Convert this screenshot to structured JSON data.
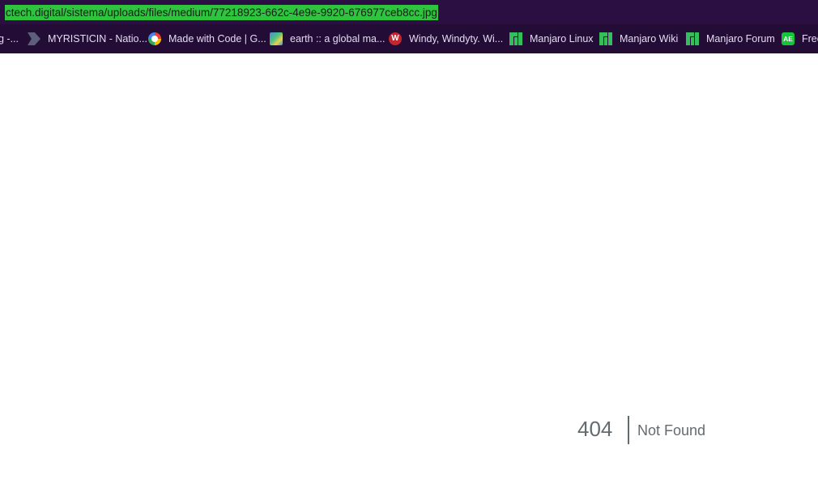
{
  "address_bar": {
    "url": "ctech.digital/sistema/uploads/files/medium/77218923-662c-4e9e-9920-676977ceb8cc.jpg"
  },
  "bookmarks": [
    {
      "label": "g -...",
      "icon": "none"
    },
    {
      "label": "MYRISTICIN - Natio...",
      "icon": "bookmark-gray-icon"
    },
    {
      "label": "Made with Code | G...",
      "icon": "google-icon"
    },
    {
      "label": "earth :: a global ma...",
      "icon": "earth-icon"
    },
    {
      "label": "Windy, Windyty. Wi...",
      "icon": "windy-icon"
    },
    {
      "label": "Manjaro Linux",
      "icon": "manjaro-icon"
    },
    {
      "label": "Manjaro Wiki",
      "icon": "manjaro-icon"
    },
    {
      "label": "Manjaro Forum",
      "icon": "manjaro-icon"
    },
    {
      "label": "Free",
      "icon": "ae-icon"
    }
  ],
  "page": {
    "error_code": "404",
    "error_message": "Not Found"
  },
  "colors": {
    "chrome_background": "#230d36",
    "url_highlight": "#2ec43e",
    "error_text": "#636b6f"
  }
}
